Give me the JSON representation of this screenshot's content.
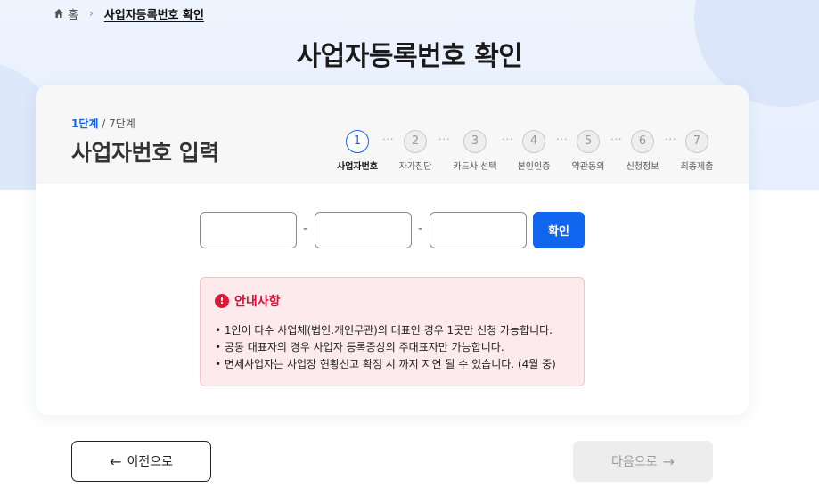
{
  "breadcrumb": {
    "home_label": "홈",
    "current": "사업자등록번호 확인"
  },
  "page_title": "사업자등록번호 확인",
  "progress": {
    "current_label": "1단계",
    "total_label": " / 7단계",
    "current_step": 1,
    "total_steps": 7
  },
  "section_title": "사업자번호 입력",
  "steps": [
    {
      "num": "1",
      "label": "사업자번호"
    },
    {
      "num": "2",
      "label": "자가진단"
    },
    {
      "num": "3",
      "label": "카드사 선택"
    },
    {
      "num": "4",
      "label": "본인인증"
    },
    {
      "num": "5",
      "label": "약관동의"
    },
    {
      "num": "6",
      "label": "신청정보"
    },
    {
      "num": "7",
      "label": "최종제출"
    }
  ],
  "form": {
    "field1_value": "",
    "field2_value": "",
    "field3_value": "",
    "separator": "-",
    "confirm_label": "확인"
  },
  "notice": {
    "title": "안내사항",
    "items": [
      "1인이 다수 사업체(법인.개인무관)의 대표인 경우 1곳만 신청 가능합니다.",
      "공동 대표자의 경우 사업자 등록증상의 주대표자만 가능합니다.",
      "면세사업자는 사업장 현황신고 확정 시 까지 지연 될 수 있습니다. (4월 중)"
    ]
  },
  "nav": {
    "prev_label": "이전으로",
    "next_label": "다음으로"
  },
  "colors": {
    "accent": "#1166f0",
    "notice_bg": "#fdeaec",
    "notice_title": "#d41136",
    "disabled_bg": "#ededed"
  }
}
